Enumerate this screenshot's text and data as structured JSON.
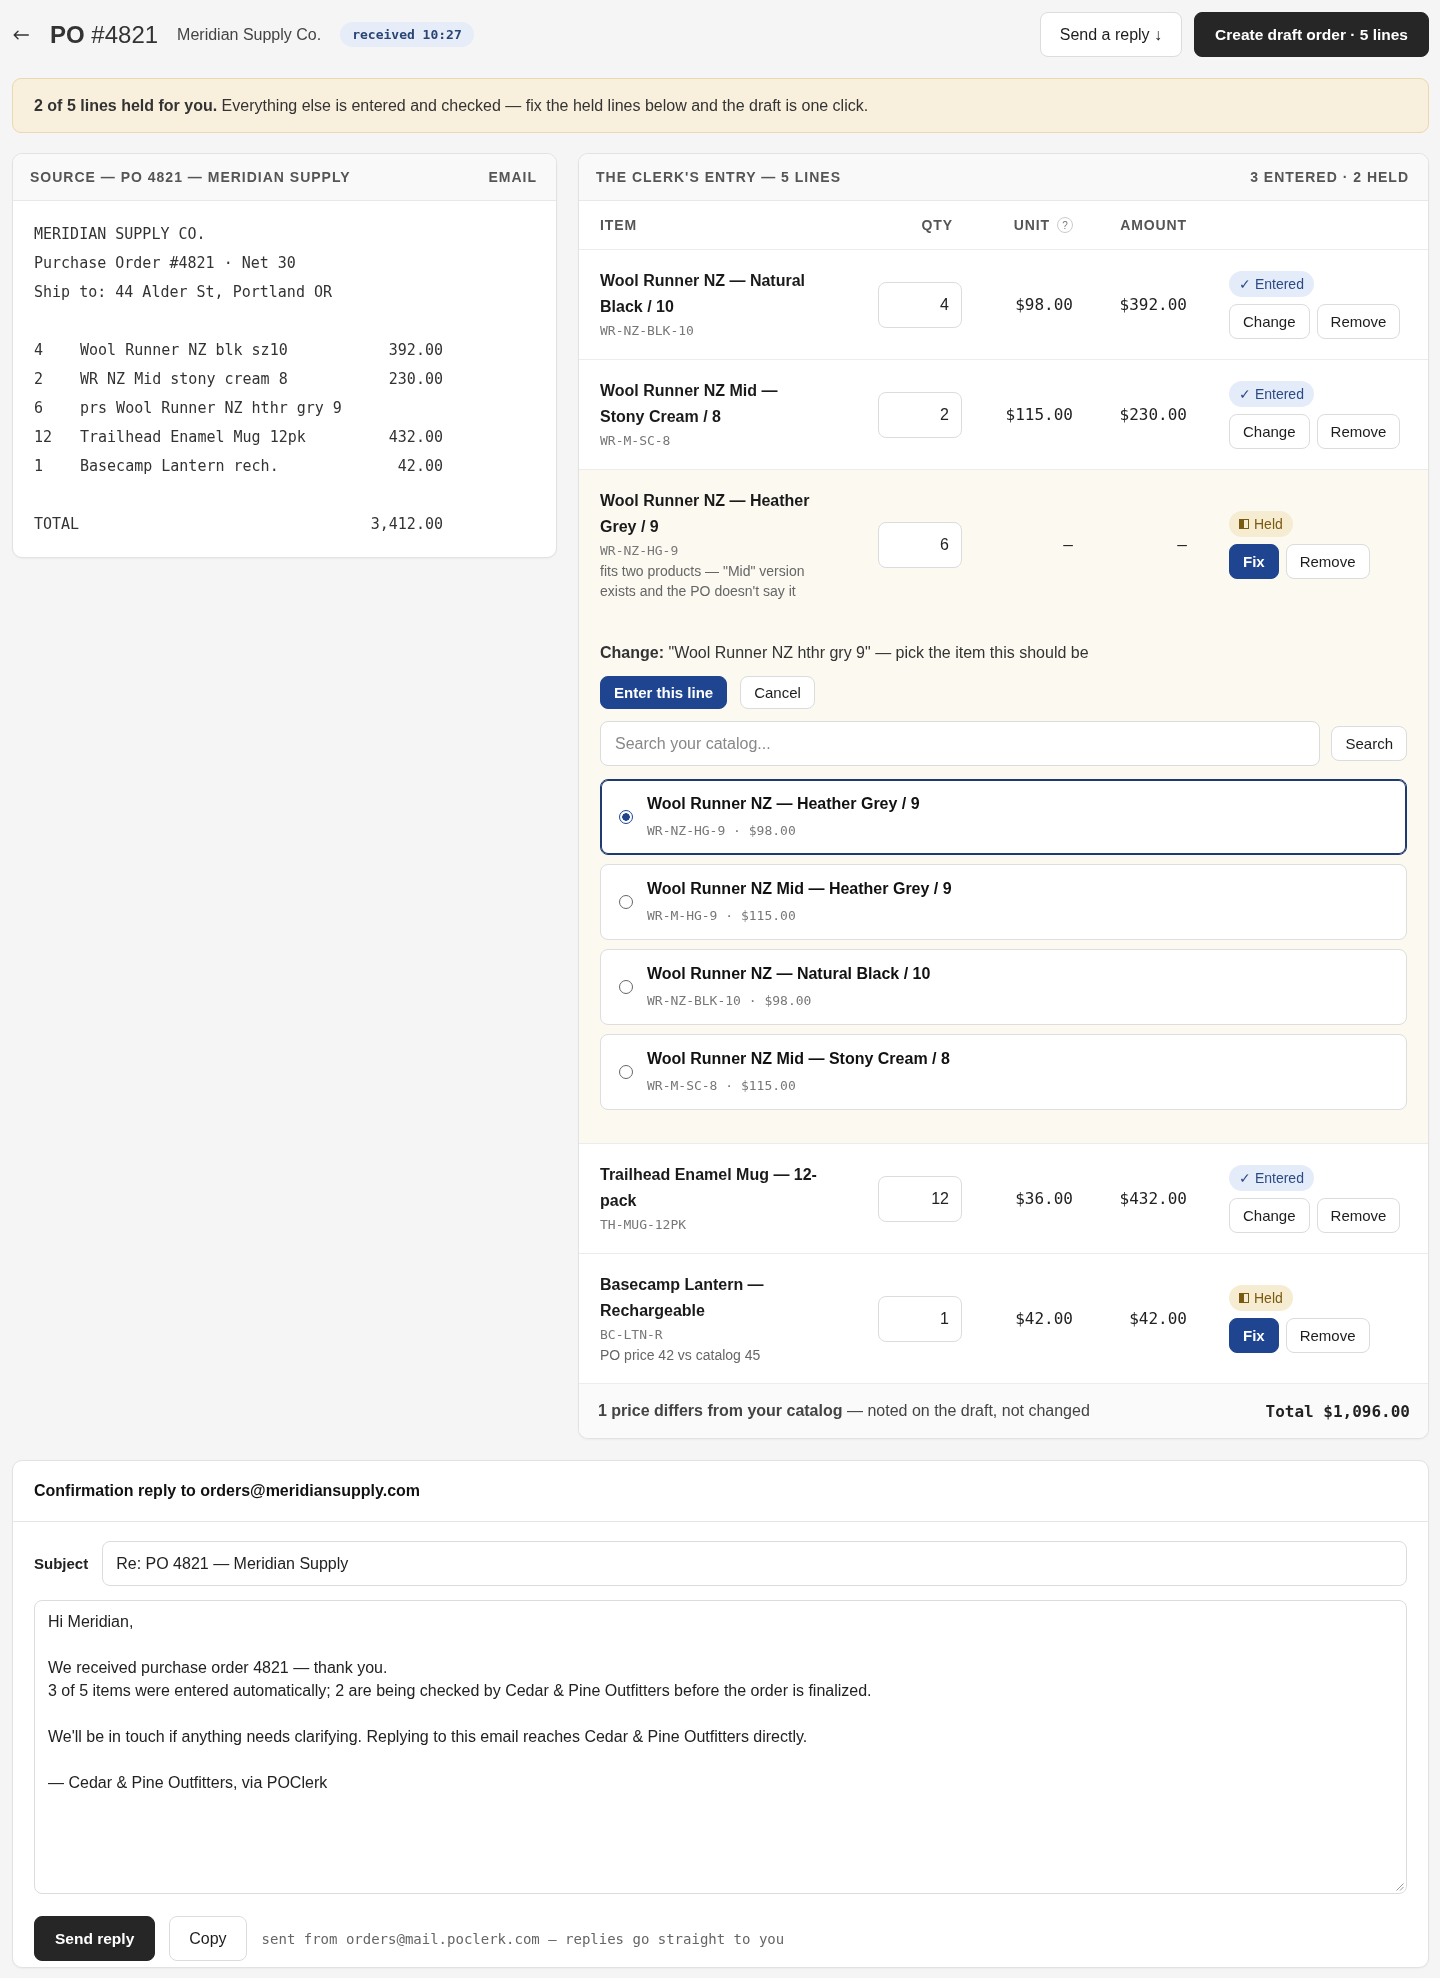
{
  "header": {
    "title": "**PO** #4821",
    "vendor": "Meridian Supply Co.",
    "received": "received 10:27",
    "actions": [
      {
        "label": "Send a reply ↓",
        "kind": "reply"
      },
      {
        "label": "Create draft order · 5 lines",
        "kind": "create"
      }
    ]
  },
  "banner": {
    "text": "**2 of 5 lines held for you.** Everything else is entered and checked — fix the held lines below and the draft is one click."
  },
  "source": {
    "title": "SOURCE — PO 4821 — MERIDIAN SUPPLY",
    "tag": "EMAIL",
    "header_lines": [
      "MERIDIAN SUPPLY CO.",
      "Purchase Order #4821 · Net 30",
      "Ship to: 44 Alder St, Portland OR"
    ],
    "lines": [
      {
        "qty": "4",
        "description": "Wool Runner NZ blk sz10",
        "amount": "392.00"
      },
      {
        "qty": "2",
        "description": "WR NZ Mid stony cream 8",
        "amount": "230.00"
      },
      {
        "qty": "6",
        "description": "prs Wool Runner NZ hthr gry 9"
      },
      {
        "qty": "12",
        "description": "Trailhead Enamel Mug 12pk",
        "amount": "432.00"
      },
      {
        "qty": "1",
        "description": "Basecamp Lantern rech.",
        "amount": "42.00"
      }
    ],
    "total_label": "TOTAL",
    "total": "3,412.00"
  },
  "entry": {
    "title": "THE CLERK'S ENTRY — 5 LINES",
    "summary": "3 ENTERED · 2 HELD",
    "columns": [
      {
        "label": "ITEM"
      },
      {
        "label": "QTY"
      },
      {
        "label": "UNIT",
        "hint": "?"
      },
      {
        "label": "AMOUNT"
      }
    ],
    "rows": [
      {
        "name": "Wool Runner NZ — Natural Black / 10",
        "sku": "WR-NZ-BLK-10",
        "qty": "4",
        "unit": "$98.00",
        "amount": "$392.00",
        "kind": "entered",
        "status_label": "✓ Entered",
        "expanded": false,
        "actions": [
          {
            "label": "Change",
            "kind": "edit"
          },
          {
            "label": "Remove",
            "kind": "remove"
          }
        ]
      },
      {
        "name": "Wool Runner NZ Mid — Stony Cream / 8",
        "sku": "WR-M-SC-8",
        "qty": "2",
        "unit": "$115.00",
        "amount": "$230.00",
        "kind": "entered",
        "status_label": "✓ Entered",
        "expanded": false,
        "actions": [
          {
            "label": "Change",
            "kind": "edit"
          },
          {
            "label": "Remove",
            "kind": "remove"
          }
        ]
      },
      {
        "name": "Wool Runner NZ — Heather Grey / 9",
        "sku": "WR-NZ-HG-9",
        "note": "fits two products — \"Mid\" version exists and the PO doesn't say it",
        "qty": "6",
        "unit": "–",
        "amount": "–",
        "kind": "held",
        "status_label": "Held",
        "expanded": true,
        "actions": [
          {
            "label": "Fix",
            "kind": "fix"
          },
          {
            "label": "Remove",
            "kind": "remove"
          }
        ],
        "change": {
          "prompt": "**Change:** \"Wool Runner NZ hthr gry 9\" — pick the item this should be",
          "buttons": [
            {
              "label": "Enter this line",
              "kind": "confirm"
            },
            {
              "label": "Cancel",
              "kind": "cancel"
            }
          ],
          "search": {
            "placeholder": "Search your catalog...",
            "button": {
              "label": "Search",
              "kind": "search"
            }
          },
          "options": [
            {
              "name": "Wool Runner NZ — Heather Grey / 9",
              "detail": "WR-NZ-HG-9 · $98.00",
              "selected": true
            },
            {
              "name": "Wool Runner NZ Mid — Heather Grey / 9",
              "detail": "WR-M-HG-9 · $115.00",
              "selected": false
            },
            {
              "name": "Wool Runner NZ — Natural Black / 10",
              "detail": "WR-NZ-BLK-10 · $98.00",
              "selected": false
            },
            {
              "name": "Wool Runner NZ Mid — Stony Cream / 8",
              "detail": "WR-M-SC-8 · $115.00",
              "selected": false
            }
          ]
        }
      },
      {
        "name": "Trailhead Enamel Mug — 12-pack",
        "sku": "TH-MUG-12PK",
        "qty": "12",
        "unit": "$36.00",
        "amount": "$432.00",
        "kind": "entered",
        "status_label": "✓ Entered",
        "expanded": false,
        "actions": [
          {
            "label": "Change",
            "kind": "edit"
          },
          {
            "label": "Remove",
            "kind": "remove"
          }
        ]
      },
      {
        "name": "Basecamp Lantern — Rechargeable",
        "sku": "BC-LTN-R",
        "note": "PO price 42 vs catalog 45",
        "qty": "1",
        "unit": "$42.00",
        "amount": "$42.00",
        "kind": "held",
        "status_label": "Held",
        "expanded": false,
        "actions": [
          {
            "label": "Fix",
            "kind": "fix"
          },
          {
            "label": "Remove",
            "kind": "remove"
          }
        ]
      }
    ],
    "footer": {
      "note": "**1 price differs from your catalog** — noted on the draft, not changed",
      "total": "Total $1,096.00"
    }
  },
  "reply": {
    "title": "Confirmation reply to orders@meridiansupply.com",
    "subject_label": "Subject",
    "subject": "Re: PO 4821 — Meridian Supply",
    "body": "Hi Meridian,\n\nWe received purchase order 4821 — thank you.\n3 of 5 items were entered automatically; 2 are being checked by Cedar & Pine Outfitters before the order is finalized.\n\nWe'll be in touch if anything needs clarifying. Replying to this email reaches Cedar & Pine Outfitters directly.\n\n— Cedar & Pine Outfitters, via POClerk",
    "buttons": [
      {
        "label": "Send reply",
        "kind": "send"
      },
      {
        "label": "Copy",
        "kind": "copy"
      }
    ],
    "footnote": "sent from orders@mail.poclerk.com — replies go straight to you"
  }
}
